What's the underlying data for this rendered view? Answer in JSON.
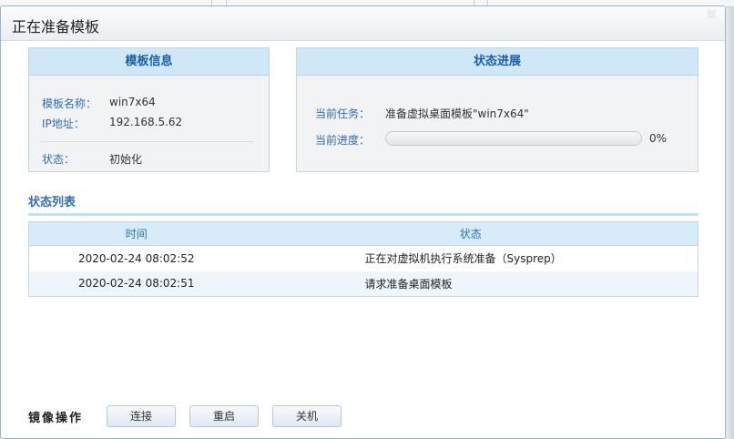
{
  "dialog": {
    "title": "正在准备模板",
    "close_glyph": "×"
  },
  "template_info": {
    "header": "模板信息",
    "name_label": "模板名称：",
    "name_value": "win7x64",
    "ip_label": "IP地址：",
    "ip_value": "192.168.5.62",
    "state_label": "状态：",
    "state_value": "初始化"
  },
  "status_progress": {
    "header": "状态进展",
    "task_label": "当前任务：",
    "task_value": "准备虚拟桌面模板\"win7x64\"",
    "progress_label": "当前进度：",
    "progress_text": "0%",
    "progress_fraction": 0
  },
  "status_list": {
    "title": "状态列表",
    "columns": [
      "时间",
      "状态"
    ],
    "rows": [
      {
        "time": "2020-02-24 08:02:52",
        "state": "正在对虚拟机执行系统准备（Sysprep）"
      },
      {
        "time": "2020-02-24 08:02:51",
        "state": "请求准备桌面模板"
      }
    ]
  },
  "image_ops": {
    "label": "镜像操作",
    "buttons": [
      "连接",
      "重启",
      "关机"
    ]
  },
  "colors": {
    "accent": "#2f6fb6",
    "header_bg": "#cfe8f7",
    "progress": "#3d93d6"
  }
}
